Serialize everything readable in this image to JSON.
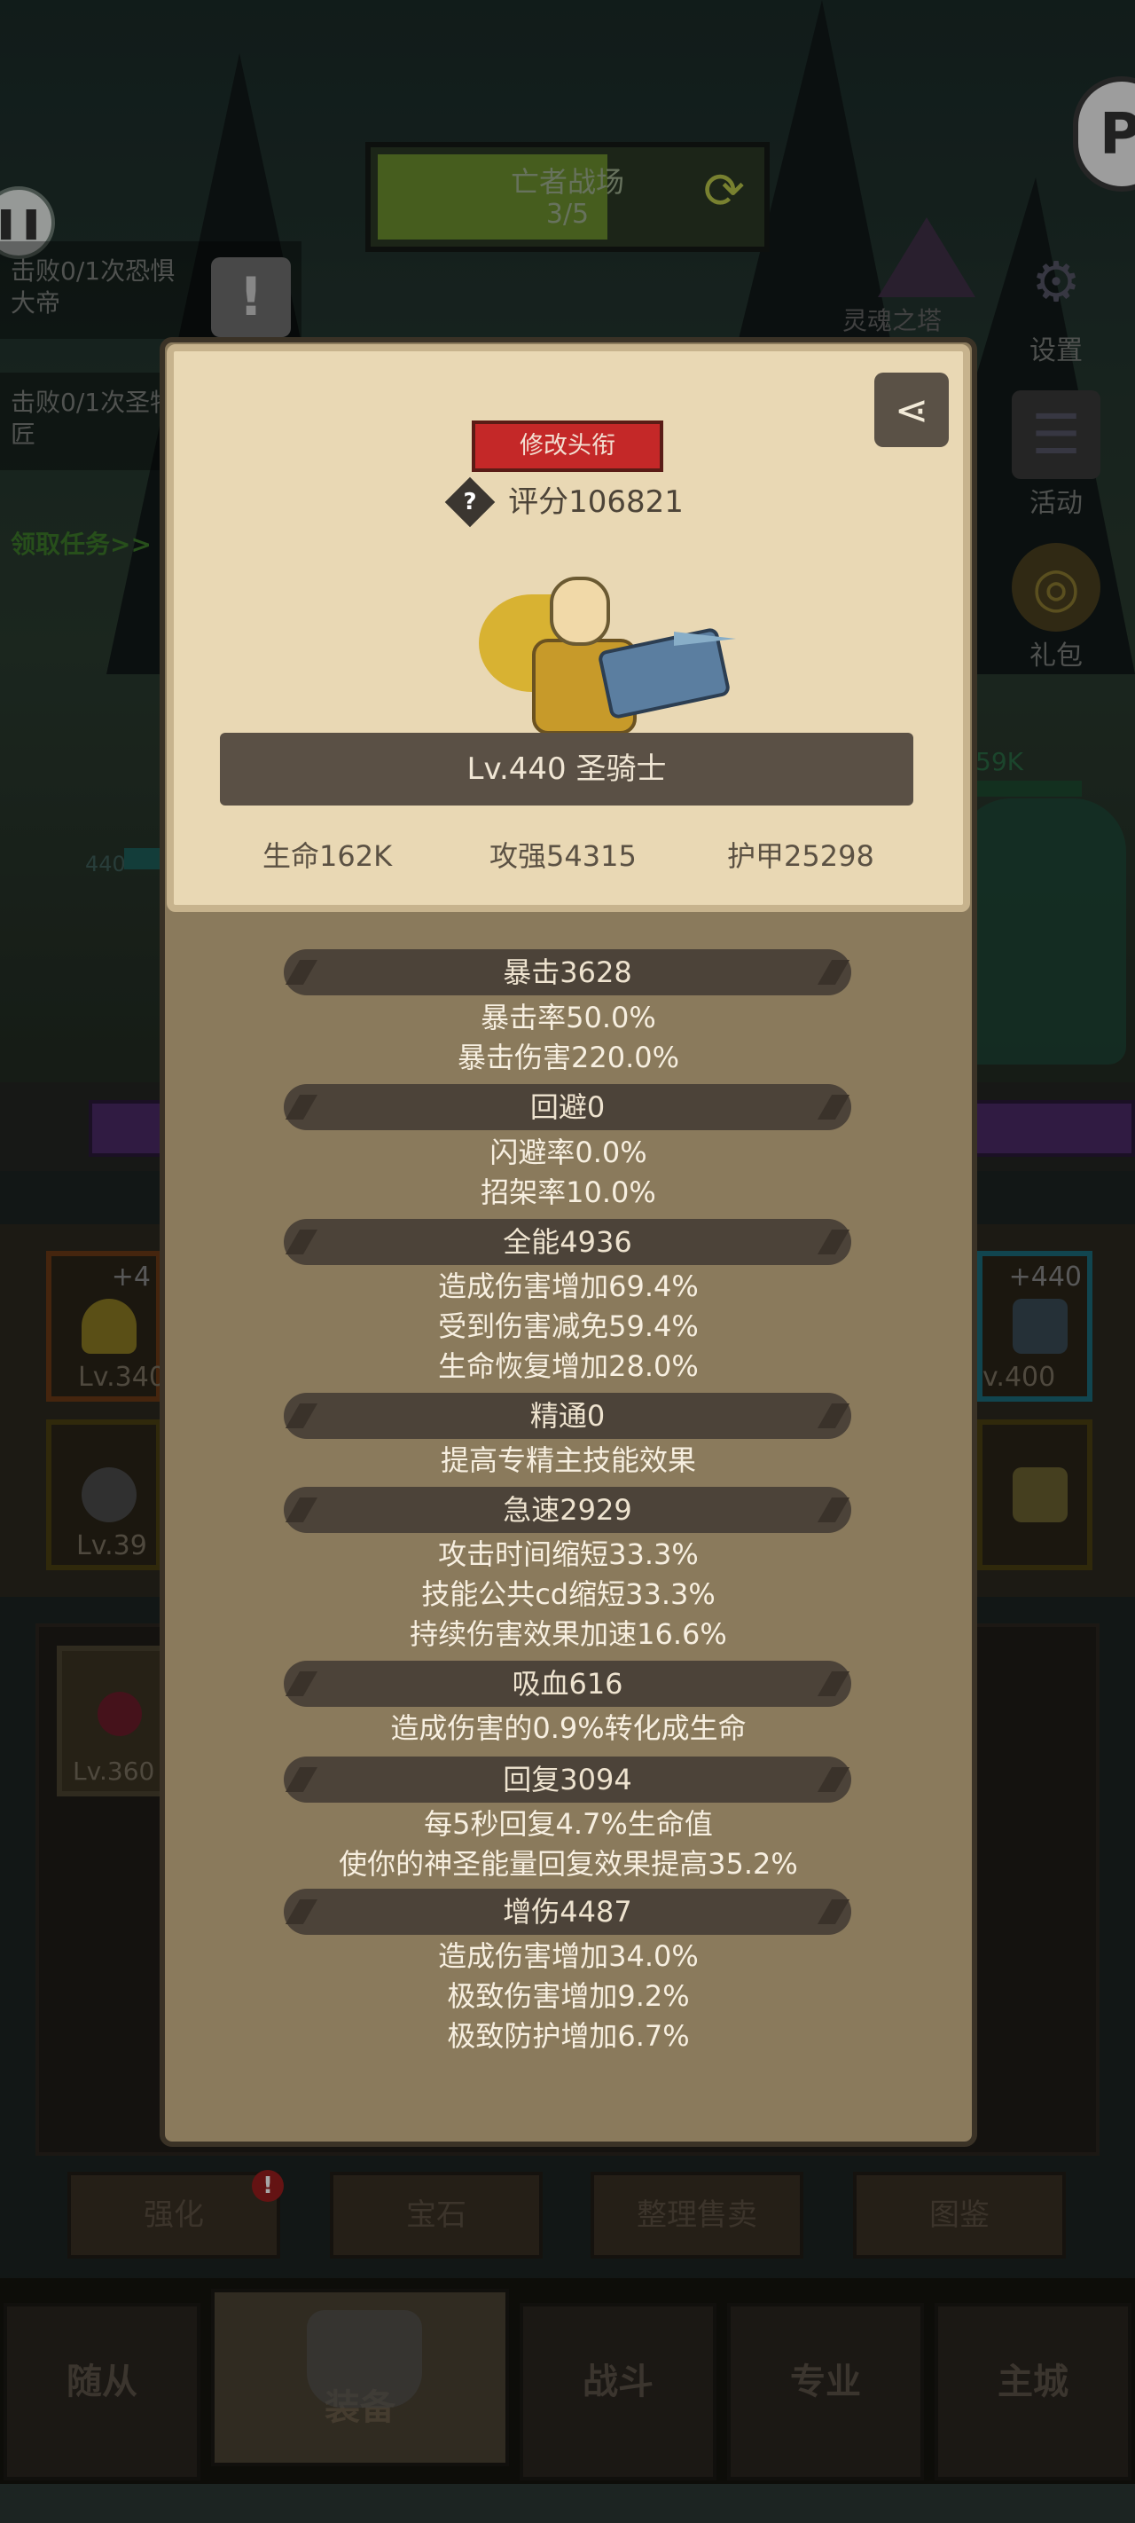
{
  "battle_banner": {
    "title": "亡者战场",
    "progress": "3/5",
    "progress_fraction": 0.6
  },
  "quests": {
    "quest1": "击败0/1次恐惧大帝",
    "quest2": "击败0/1次圣物匠",
    "claim": "领取任务>>"
  },
  "side_menu": {
    "soul_tower": "灵魂之塔",
    "settings": "设置",
    "events": "活动",
    "gift": "礼包"
  },
  "battlefield": {
    "enemy_hp": "59K",
    "hero_level": "440"
  },
  "equipment_slots": {
    "left_top_plus": "+4",
    "left_top_lv": "Lv.340",
    "left_bottom_lv": "Lv.39",
    "right_top_plus": "+440",
    "right_top_lv": "v.400"
  },
  "bag": {
    "item_lv": "Lv.360"
  },
  "popup": {
    "rename_button": "修改头衔",
    "help_symbol": "?",
    "score": "评分106821",
    "hero_name": "Lv.440 圣骑士",
    "hp": "生命162K",
    "attack": "攻强54315",
    "armor": "护甲25298",
    "sections": [
      {
        "header": "暴击3628",
        "details": [
          "暴击率50.0%",
          "暴击伤害220.0%"
        ]
      },
      {
        "header": "回避0",
        "details": [
          "闪避率0.0%",
          "招架率10.0%"
        ]
      },
      {
        "header": "全能4936",
        "details": [
          "造成伤害增加69.4%",
          "受到伤害减免59.4%",
          "生命恢复增加28.0%"
        ]
      },
      {
        "header": "精通0",
        "details": [
          "提高专精主技能效果"
        ]
      },
      {
        "header": "急速2929",
        "details": [
          "攻击时间缩短33.3%",
          "技能公共cd缩短33.3%",
          "持续伤害效果加速16.6%"
        ]
      },
      {
        "header": "吸血616",
        "details": [
          "造成伤害的0.9%转化成生命"
        ]
      },
      {
        "header": "回复3094",
        "details": [
          "每5秒回复4.7%生命值",
          "使你的神圣能量回复效果提高35.2%"
        ]
      },
      {
        "header": "增伤4487",
        "details": [
          "造成伤害增加34.0%",
          "极致伤害增加9.2%",
          "极致防护增加6.7%"
        ]
      }
    ]
  },
  "actions": {
    "enhance": "强化",
    "alert": "!",
    "gem": "宝石",
    "sort_sell": "整理售卖",
    "codex": "图鉴"
  },
  "nav": {
    "followers": "随从",
    "equipment": "装备",
    "battle": "战斗",
    "profession": "专业",
    "main_city": "主城"
  },
  "icons": {
    "refresh": "refresh-icon",
    "pause": "pause-icon",
    "settings": "gear-icon",
    "events": "scroll-icon",
    "gift": "gift-bag-icon",
    "share": "share-icon",
    "help": "question-diamond-icon"
  },
  "colors": {
    "title_button": "#c42828",
    "claim_text": "#3d7a2a",
    "parchment": "#e9d8b4",
    "popup_body": "#8a7a5c"
  }
}
